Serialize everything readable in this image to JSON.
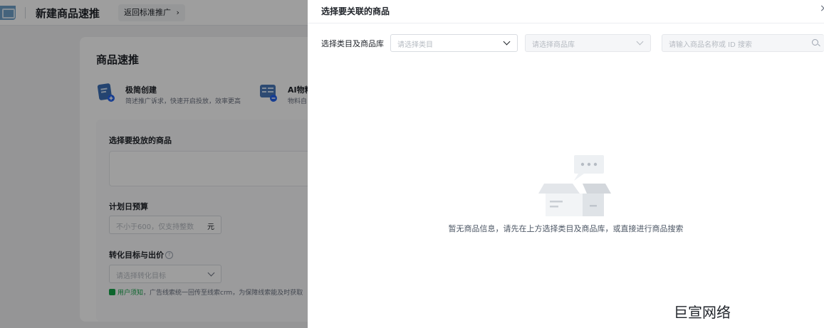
{
  "header": {
    "page_title": "新建商品速推",
    "back_link": "返回标准推广",
    "back_link_arrow": "›"
  },
  "panel": {
    "title": "商品速推",
    "modes": [
      {
        "title": "极简创建",
        "desc": "简述推广诉求，快速开启投放，效率更高",
        "icon": "document-plus-icon"
      },
      {
        "title": "AI物料",
        "desc": "物料自",
        "icon": "ai-form-icon"
      }
    ],
    "product_label": "选择要投放的商品",
    "budget_label": "计划日预算",
    "budget_placeholder": "不小于600，仅支持整数",
    "budget_unit": "元",
    "target_label": "转化目标与出价",
    "target_help": "?",
    "target_placeholder": "请选择转化目标",
    "notice_link": "用户须知",
    "notice_text": "，广告线索统一回传至线索crm，为保障线索能及时获取"
  },
  "drawer": {
    "title": "选择要关联的商品",
    "close": "×",
    "filter_label": "选择类目及商品库",
    "category_placeholder": "请选择类目",
    "library_placeholder": "请选择商品库",
    "search_placeholder": "请输入商品名称或 ID 搜索",
    "empty_text": "暂无商品信息，请先在上方选择类目及商品库，或直接进行商品搜索"
  },
  "watermark": "巨宣网络",
  "colors": {
    "accent_green": "#16a34a",
    "overlay": "rgba(0,0,0,0.38)",
    "page_bg": "#f0f1f3"
  }
}
